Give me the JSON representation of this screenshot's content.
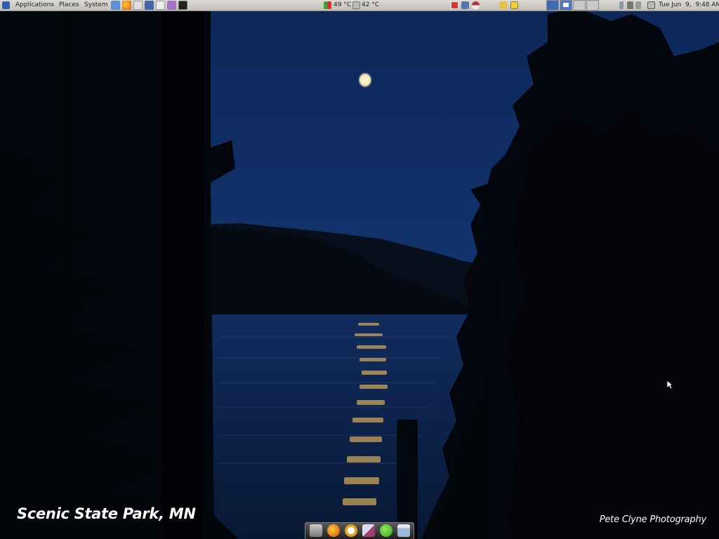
{
  "panel": {
    "menus": {
      "applications": "Applications",
      "places": "Places",
      "system": "System"
    },
    "sensors": {
      "temp1": "49 °C",
      "temp2": "42 °C"
    },
    "clock": "Tue Jun  9,  9:48 AM"
  },
  "wallpaper": {
    "caption_location": "Scenic State Park, MN",
    "caption_credit": "Pete Clyne Photography"
  },
  "colors": {
    "panel_bg": "#d6d4cf",
    "sky": "#0e2a5c",
    "water": "#0c2147",
    "moon": "#fff6d8"
  },
  "icons": {
    "launchers": [
      "ubuntu-icon",
      "box-icon",
      "firefox-icon",
      "network-icon",
      "terminal-icon"
    ],
    "dock": [
      "drive-icon",
      "firefox-icon",
      "clock-icon",
      "image-viewer-icon",
      "green-dot-icon",
      "window-icon"
    ]
  }
}
